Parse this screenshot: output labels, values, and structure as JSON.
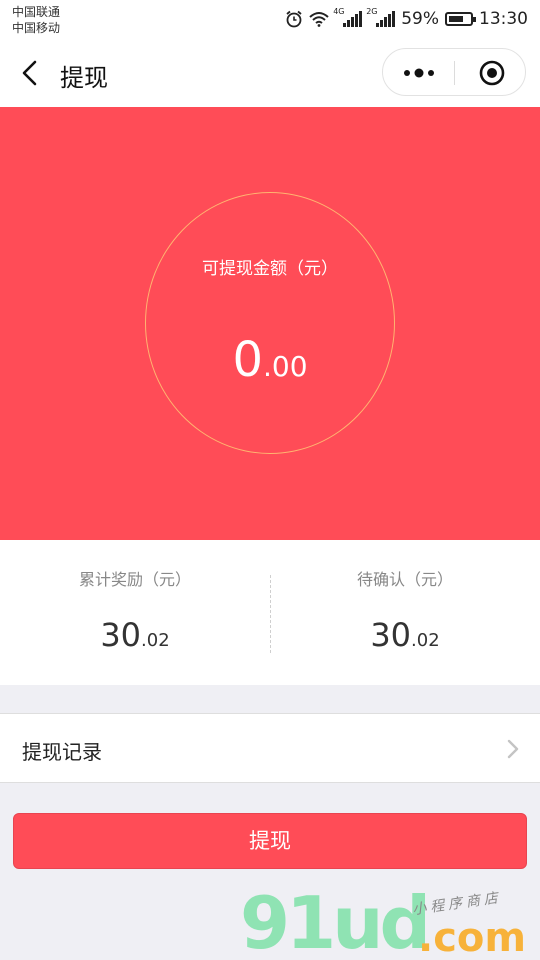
{
  "status_bar": {
    "carrier1": "中国联通",
    "carrier2": "中国移动",
    "net1": "4G",
    "net2": "2G",
    "battery": "59%",
    "time": "13:30"
  },
  "nav": {
    "title": "提现"
  },
  "hero": {
    "label": "可提现金额（元）",
    "amount_int": "0",
    "amount_dec": ".00"
  },
  "stats": {
    "total": {
      "label": "累计奖励（元）",
      "int": "30",
      "dec": ".02"
    },
    "pending": {
      "label": "待确认（元）",
      "int": "30",
      "dec": ".02"
    }
  },
  "record": {
    "label": "提现记录"
  },
  "button": {
    "label": "提现"
  },
  "watermark": {
    "main": "91ud",
    "com": ".com",
    "sub": "小程序商店"
  },
  "colors": {
    "accent": "#ff4c57",
    "background": "#efeff4"
  },
  "icons": [
    "alarm-icon",
    "wifi-icon",
    "signal-icon",
    "battery-icon",
    "back-icon",
    "more-icon",
    "target-icon",
    "chevron-right-icon"
  ]
}
